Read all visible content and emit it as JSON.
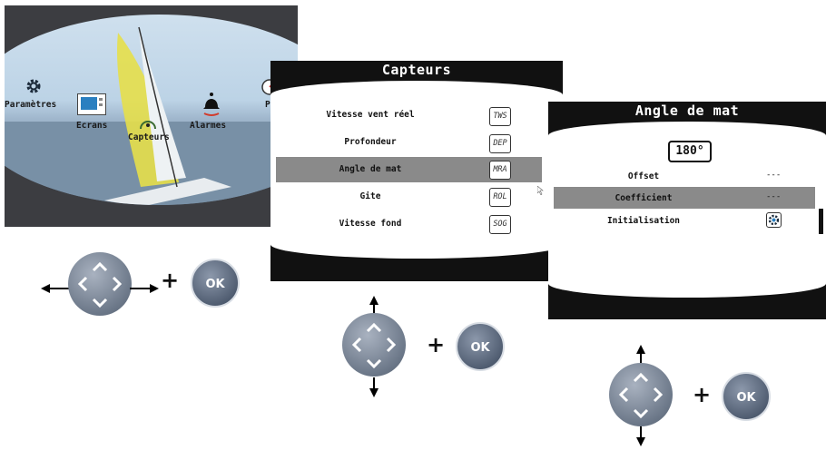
{
  "screen1": {
    "menu": [
      {
        "label": "Paramètres",
        "icon": "gear-icon"
      },
      {
        "label": "Ecrans",
        "icon": "screens-icon"
      },
      {
        "label": "Capteurs",
        "icon": "sensor-icon"
      },
      {
        "label": "Alarmes",
        "icon": "bell-icon"
      },
      {
        "label": "Pil",
        "icon": "autopilot-icon"
      }
    ]
  },
  "screen2": {
    "title": "Capteurs",
    "rows": [
      {
        "label": "Vitesse vent réel",
        "tag": "TWS"
      },
      {
        "label": "Profondeur",
        "tag": "DEP"
      },
      {
        "label": "Angle de mat",
        "tag": "MRA"
      },
      {
        "label": "Gite",
        "tag": "ROL"
      },
      {
        "label": "Vitesse fond",
        "tag": "SOG"
      }
    ],
    "selected_index": 2
  },
  "screen3": {
    "title": "Angle de mat",
    "value": "180°",
    "rows": [
      {
        "label": "Offset",
        "value": "---"
      },
      {
        "label": "Coefficient",
        "value": "---"
      },
      {
        "label": "Initialisation",
        "icon": "gear-icon"
      }
    ],
    "selected_index": 1
  },
  "controls": {
    "ok_label": "OK",
    "plus": "+"
  },
  "colors": {
    "selection_gray": "#8a8a8a",
    "frame_black": "#111111",
    "alarm_red": "#d23a2a",
    "screens_blue": "#2a7fc0"
  }
}
